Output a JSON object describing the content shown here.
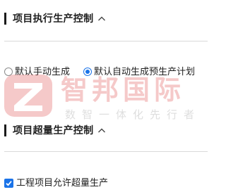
{
  "sections": {
    "execution": {
      "title": "项目执行生产控制",
      "collapse_icon": "chevron-up-icon"
    },
    "overproduction": {
      "title": "项目超量生产控制",
      "collapse_icon": "chevron-up-icon"
    }
  },
  "production_mode": {
    "options": [
      {
        "label": "默认手动生成",
        "selected": false
      },
      {
        "label": "默认自动生成预生产计划",
        "selected": true
      }
    ]
  },
  "overproduction_setting": {
    "label": "工程项目允许超量生产",
    "checked": true
  },
  "watermark": {
    "brand": "智邦国际",
    "slogan": "数智一体化先行者",
    "logo_icon": "z-logo-icon"
  },
  "colors": {
    "accent": "#1a73e8",
    "watermark_red": "#e25b5b"
  }
}
